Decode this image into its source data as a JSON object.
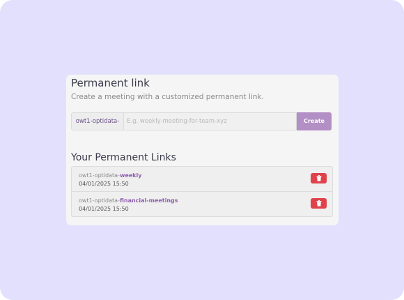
{
  "header": {
    "title": "Permanent link",
    "subtitle": "Create a meeting with a customized permanent link."
  },
  "form": {
    "prefix": "owt1-optidata-",
    "placeholder": "E.g. weekly-meeting-for-team-xyz",
    "create_label": "Create"
  },
  "links_section": {
    "title": "Your Permanent Links",
    "items": [
      {
        "prefix": "owt1-optidata-",
        "slug": "weekly",
        "date": "04/01/2025 15:50",
        "delete_icon": "trash-icon"
      },
      {
        "prefix": "owt1-optidata-",
        "slug": "financial-meetings",
        "date": "04/01/2025 15:50",
        "delete_icon": "trash-icon"
      }
    ]
  },
  "colors": {
    "background": "#e3e0fd",
    "card": "#f5f5f5",
    "accent": "#b28fc4",
    "slug": "#8f5fae",
    "danger": "#e0424b"
  }
}
